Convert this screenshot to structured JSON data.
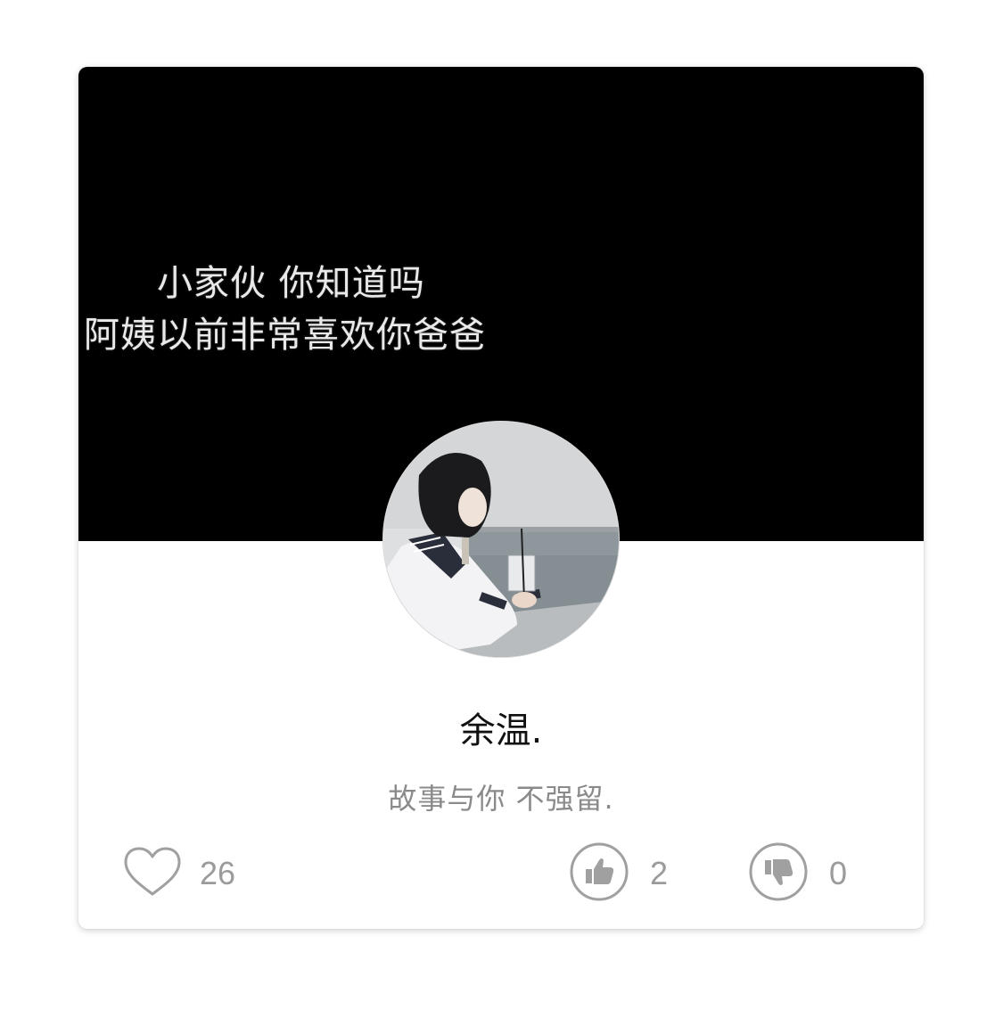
{
  "cover": {
    "line1": "小家伙 你知道吗",
    "line2": "阿姨以前非常喜欢你爸爸"
  },
  "profile": {
    "name": "余温.",
    "bio": "故事与你 不强留."
  },
  "stats": {
    "likes": "26",
    "upvotes": "2",
    "downvotes": "0"
  },
  "icons": {
    "like": "heart-outline-icon",
    "upvote": "thumbs-up-icon",
    "downvote": "thumbs-down-icon"
  },
  "colors": {
    "cover_bg": "#000000",
    "icon_gray": "#a0a0a0",
    "count_gray": "#9b9b9b",
    "bio_gray": "#8a8a8a"
  }
}
